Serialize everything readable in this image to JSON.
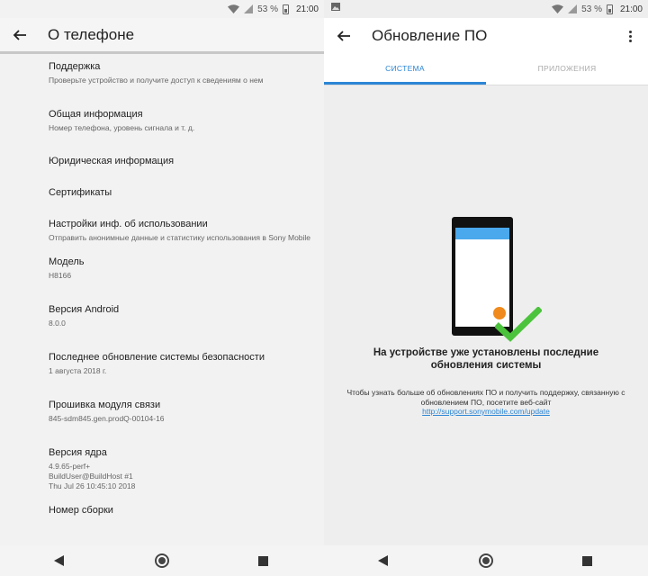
{
  "status": {
    "battery": "53 %",
    "time": "21:00"
  },
  "left": {
    "title": "О телефоне",
    "items": [
      {
        "title": "Поддержка",
        "sub": "Проверьте устройство и получите доступ к сведениям о нем"
      },
      {
        "title": "Общая информация",
        "sub": "Номер телефона, уровень сигнала и т. д."
      },
      {
        "title": "Юридическая информация",
        "sub": ""
      },
      {
        "title": "Сертификаты",
        "sub": ""
      },
      {
        "title": "Настройки инф. об использовании",
        "sub": "Отправить анонимные данные и статистику использования в Sony Mobile"
      },
      {
        "title": "Модель",
        "sub": "H8166"
      },
      {
        "title": "Версия Android",
        "sub": "8.0.0"
      },
      {
        "title": "Последнее обновление системы безопасности",
        "sub": "1 августа 2018 г."
      },
      {
        "title": "Прошивка модуля связи",
        "sub": "845-sdm845.gen.prodQ-00104-16"
      },
      {
        "title": "Версия ядра",
        "sub": "4.9.65-perf+\nBuildUser@BuildHost #1\nThu Jul 26 10:45:10 2018"
      },
      {
        "title": "Номер сборки",
        "sub": ""
      }
    ]
  },
  "right": {
    "title": "Обновление ПО",
    "tabs": [
      "СИСТЕМА",
      "ПРИЛОЖЕНИЯ"
    ],
    "message_title": "На устройстве уже установлены последние обновления системы",
    "message_body": "Чтобы узнать больше об обновлениях ПО и получить поддержку, связанную с обновлением ПО, посетите веб-сайт",
    "link": "http://support.sonymobile.com/update"
  },
  "icons": {
    "back": "arrow-left-icon",
    "more": "more-vert-icon",
    "wifi": "wifi-icon",
    "signal": "signal-icon",
    "battery": "battery-icon",
    "gallery": "image-icon",
    "nav_back": "triangle-back-icon",
    "nav_home": "home-circle-icon",
    "nav_recent": "square-recent-icon"
  },
  "colors": {
    "accent": "#2c86d4",
    "check": "#4cc33c",
    "orange": "#f08a1c",
    "phone_bar": "#4aa8ec"
  }
}
